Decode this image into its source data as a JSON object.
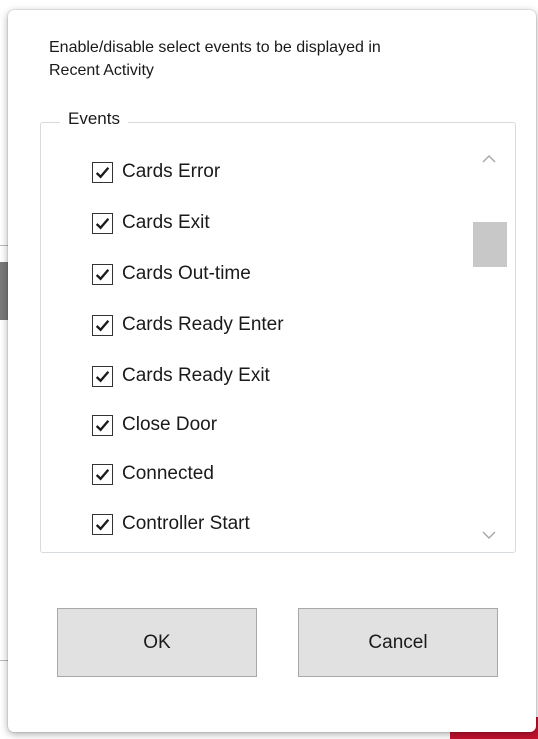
{
  "dialog": {
    "description": "Enable/disable select events to be displayed in Recent Activity",
    "group_label": "Events",
    "events": [
      {
        "label": "Cards Error",
        "checked": true
      },
      {
        "label": "Cards Exit",
        "checked": true
      },
      {
        "label": "Cards Out-time",
        "checked": true
      },
      {
        "label": "Cards Ready Enter",
        "checked": true
      },
      {
        "label": "Cards Ready Exit",
        "checked": true
      },
      {
        "label": "Close Door",
        "checked": true
      },
      {
        "label": "Connected",
        "checked": true
      },
      {
        "label": "Controller Start",
        "checked": true
      }
    ],
    "ok_label": "OK",
    "cancel_label": "Cancel"
  },
  "icons": {
    "checkmark": "checkmark-icon",
    "scroll_up": "chevron-up-icon",
    "scroll_down": "chevron-down-icon"
  },
  "colors": {
    "accent_red": "#c4122e",
    "button_bg": "#e1e1e1",
    "scroll_thumb": "#c8c8c8"
  }
}
